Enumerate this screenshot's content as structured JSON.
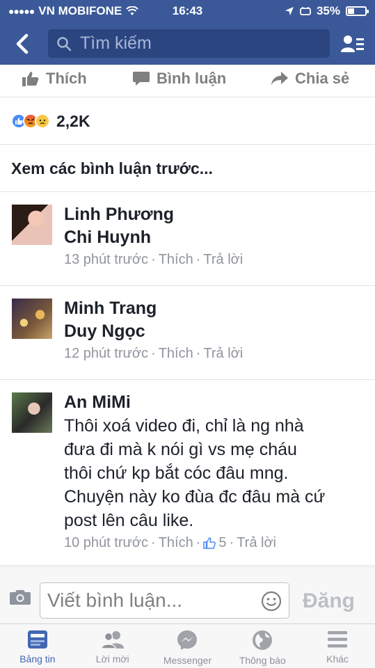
{
  "status_bar": {
    "carrier": "VN MOBIFONE",
    "time": "16:43",
    "battery": "35%",
    "battery_level": 0.35
  },
  "header": {
    "search_placeholder": "Tìm kiếm"
  },
  "actions": {
    "like": "Thích",
    "comment": "Bình luận",
    "share": "Chia sẻ"
  },
  "reactions": {
    "count": "2,2K",
    "icons": [
      "like-icon",
      "angry-icon",
      "sad-icon"
    ]
  },
  "previous_comments": "Xem các bình luận trước...",
  "comments": [
    {
      "name_line1": "Linh Phương",
      "name_line2": "Chi Huynh",
      "time": "13 phút trước",
      "like": "Thích",
      "reply": "Trả lời"
    },
    {
      "name_line1": "Minh Trang",
      "name_line2": "Duy Ngọc",
      "time": "12 phút trước",
      "like": "Thích",
      "reply": "Trả lời"
    },
    {
      "name": "An MiMi",
      "text_lines": [
        "Thôi xoá video đi, chỉ là ng nhà",
        "đưa đi mà k nói gì vs mẹ cháu",
        "thôi chứ kp bắt cóc đâu mng.",
        "Chuyện này ko đùa đc đâu mà cứ",
        "post lên câu like."
      ],
      "time": "10 phút trước",
      "like": "Thích",
      "likes_count": "5",
      "reply": "Trả lời"
    }
  ],
  "composer": {
    "placeholder": "Viết bình luận...",
    "post_label": "Đăng"
  },
  "tabs": [
    {
      "label": "Bảng tin",
      "icon": "news-feed-icon",
      "active": true
    },
    {
      "label": "Lời mời",
      "icon": "friend-requests-icon",
      "active": false
    },
    {
      "label": "Messenger",
      "icon": "messenger-icon",
      "active": false
    },
    {
      "label": "Thông báo",
      "icon": "globe-icon",
      "active": false
    },
    {
      "label": "Khác",
      "icon": "menu-icon",
      "active": false
    }
  ],
  "colors": {
    "brand": "#3b5998",
    "active_tab": "#4267b2",
    "meta_text": "#90949c"
  }
}
